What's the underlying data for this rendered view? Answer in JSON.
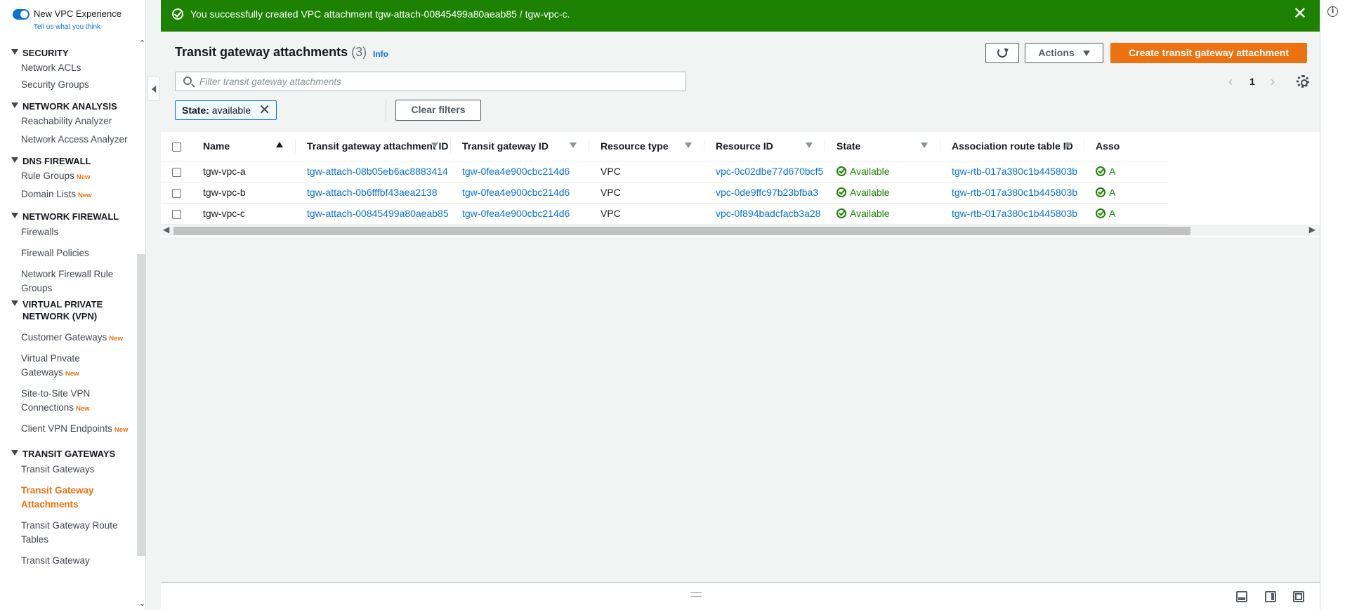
{
  "sidebar": {
    "toggle_label": "New VPC Experience",
    "feedback_link": "Tell us what you think",
    "sections": [
      {
        "title": "SECURITY",
        "items": [
          {
            "label": "Network ACLs"
          },
          {
            "label": "Security Groups"
          }
        ]
      },
      {
        "title": "NETWORK ANALYSIS",
        "items": [
          {
            "label": "Reachability Analyzer"
          },
          {
            "label": "Network Access Analyzer"
          }
        ]
      },
      {
        "title": "DNS FIREWALL",
        "items": [
          {
            "label": "Rule Groups",
            "badge": "New"
          },
          {
            "label": "Domain Lists",
            "badge": "New"
          }
        ]
      },
      {
        "title": "NETWORK FIREWALL",
        "items": [
          {
            "label": "Firewalls"
          },
          {
            "label": "Firewall Policies"
          },
          {
            "label": "Network Firewall Rule Groups"
          }
        ]
      },
      {
        "title": "VIRTUAL PRIVATE NETWORK (VPN)",
        "items": [
          {
            "label": "Customer Gateways",
            "badge": "New"
          },
          {
            "label": "Virtual Private Gateways",
            "badge": "New"
          },
          {
            "label": "Site-to-Site VPN Connections",
            "badge": "New"
          },
          {
            "label": "Client VPN Endpoints",
            "badge": "New"
          }
        ]
      },
      {
        "title": "TRANSIT GATEWAYS",
        "items": [
          {
            "label": "Transit Gateways"
          },
          {
            "label": "Transit Gateway Attachments",
            "active": true
          },
          {
            "label": "Transit Gateway Route Tables"
          },
          {
            "label": "Transit Gateway"
          }
        ]
      }
    ]
  },
  "flash": {
    "message": "You successfully created VPC attachment tgw-attach-00845499a80aeab85 / tgw-vpc-c.",
    "close": "✕"
  },
  "header": {
    "title": "Transit gateway attachments",
    "count": "(3)",
    "info": "Info",
    "actions_label": "Actions",
    "create_label": "Create transit gateway attachment"
  },
  "filter": {
    "placeholder": "Filter transit gateway attachments",
    "token_key": "State:",
    "token_value": "available",
    "clear_label": "Clear filters"
  },
  "pagination": {
    "current": "1",
    "prev": "‹",
    "next": "›"
  },
  "table": {
    "columns": [
      "Name",
      "Transit gateway attachment ID",
      "Transit gateway ID",
      "Resource type",
      "Resource ID",
      "State",
      "Association route table ID",
      "Asso"
    ],
    "rows": [
      {
        "name": "tgw-vpc-a",
        "attachment_id": "tgw-attach-08b05eb6ac8883414",
        "tgw_id": "tgw-0fea4e900cbc214d6",
        "resource_type": "VPC",
        "resource_id": "vpc-0c02dbe77d670bcf5",
        "state": "Available",
        "route_table": "tgw-rtb-017a380c1b445803b",
        "assoc": "A"
      },
      {
        "name": "tgw-vpc-b",
        "attachment_id": "tgw-attach-0b6fffbf43aea2138",
        "tgw_id": "tgw-0fea4e900cbc214d6",
        "resource_type": "VPC",
        "resource_id": "vpc-0de9ffc97b23bfba3",
        "state": "Available",
        "route_table": "tgw-rtb-017a380c1b445803b",
        "assoc": "A"
      },
      {
        "name": "tgw-vpc-c",
        "attachment_id": "tgw-attach-00845499a80aeab85",
        "tgw_id": "tgw-0fea4e900cbc214d6",
        "resource_type": "VPC",
        "resource_id": "vpc-0f894badcfacb3a28",
        "state": "Available",
        "route_table": "tgw-rtb-017a380c1b445803b",
        "assoc": "A"
      }
    ]
  },
  "colors": {
    "flash_success": "#1d8102",
    "primary": "#ec7211",
    "link": "#0972d3"
  }
}
